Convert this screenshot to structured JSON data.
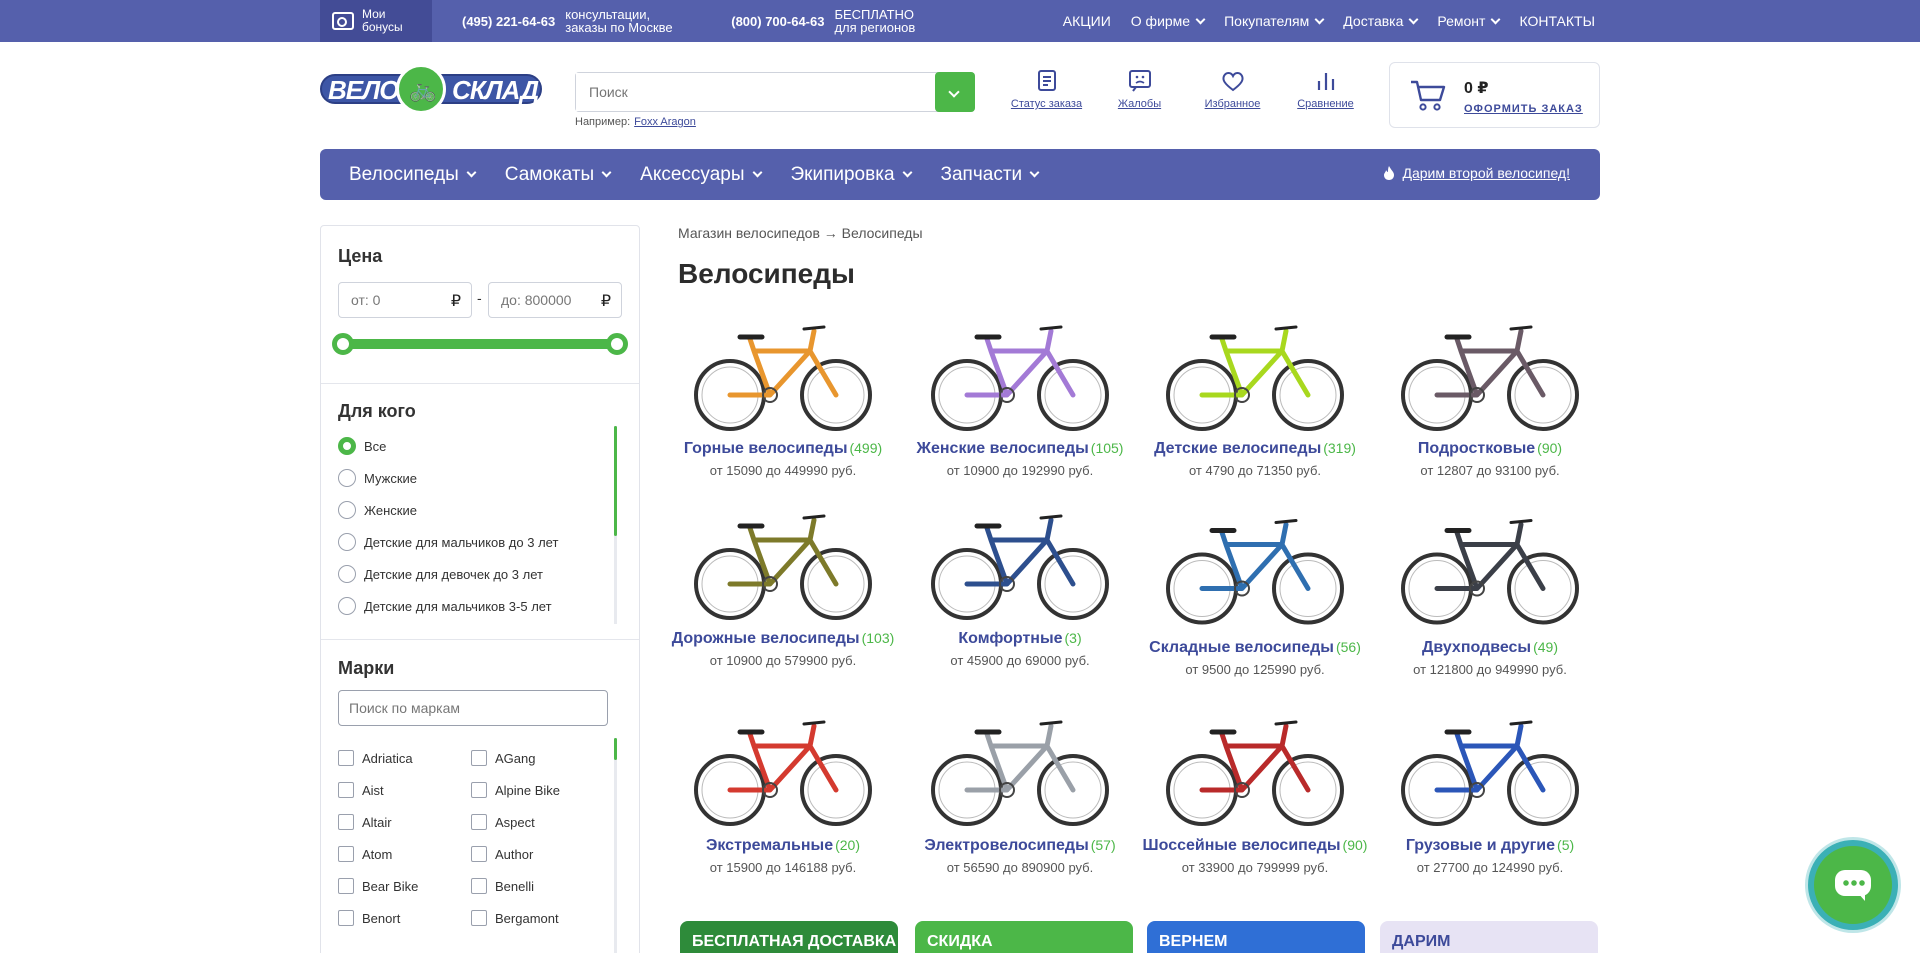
{
  "topbar": {
    "bonus": "Мои бонусы",
    "phones": [
      {
        "number": "(495) 221-64-63",
        "note": "консультации, заказы по Москве"
      },
      {
        "number": "(800) 700-64-63",
        "note": "БЕСПЛАТНО для регионов"
      }
    ],
    "nav": [
      {
        "label": "АКЦИИ",
        "dropdown": false
      },
      {
        "label": "О фирме",
        "dropdown": true
      },
      {
        "label": "Покупателям",
        "dropdown": true
      },
      {
        "label": "Доставка",
        "dropdown": true
      },
      {
        "label": "Ремонт",
        "dropdown": true
      },
      {
        "label": "КОНТАКТЫ",
        "dropdown": false
      }
    ]
  },
  "logo": {
    "left": "ВЕЛО",
    "right": "СКЛАД"
  },
  "search": {
    "placeholder": "Поиск",
    "example_label": "Например:",
    "example_link": "Foxx Aragon"
  },
  "header_icons": [
    {
      "icon": "order-status-icon",
      "label": "Статус заказа"
    },
    {
      "icon": "complaints-icon",
      "label": "Жалобы"
    },
    {
      "icon": "heart-icon",
      "label": "Избранное"
    },
    {
      "icon": "compare-icon",
      "label": "Сравнение"
    }
  ],
  "cart": {
    "sum": "0 ₽",
    "order": "ОФОРМИТЬ ЗАКАЗ"
  },
  "main_nav": {
    "items": [
      "Велосипеды",
      "Самокаты",
      "Аксессуары",
      "Экипировка",
      "Запчасти"
    ],
    "promo": "Дарим второй велосипед!"
  },
  "filters": {
    "price": {
      "title": "Цена",
      "from": "от: 0",
      "to": "до: 800000",
      "currency": "₽"
    },
    "who": {
      "title": "Для кого",
      "options": [
        "Все",
        "Мужские",
        "Женские",
        "Детские для мальчиков до 3 лет",
        "Детские для девочек до 3 лет",
        "Детские для мальчиков 3-5 лет"
      ],
      "selected": 0
    },
    "brands": {
      "title": "Марки",
      "placeholder": "Поиск по маркам",
      "col1": [
        "Adriatica",
        "Aist",
        "Altair",
        "Atom",
        "Bear Bike",
        "Benort"
      ],
      "col2": [
        "AGang",
        "Alpine Bike",
        "Aspect",
        "Author",
        "Benelli",
        "Bergamont"
      ]
    }
  },
  "breadcrumbs": "Магазин велосипедов → Велосипеды",
  "page_title": "Велосипеды",
  "categories": [
    {
      "name": "Горные велосипеды",
      "count": "(499)",
      "range": "от 15090 до 449990 руб.",
      "color": "#e8962e"
    },
    {
      "name": "Женские велосипеды",
      "count": "(105)",
      "range": "от 10900 до 192990 руб.",
      "color": "#a37ad6"
    },
    {
      "name": "Детские велосипеды",
      "count": "(319)",
      "range": "от 4790 до 71350 руб.",
      "color": "#a8d81e"
    },
    {
      "name": "Подростковые",
      "count": "(90)",
      "range": "от 12807 до 93100 руб.",
      "color": "#6a5a66"
    },
    {
      "name": "Дорожные велосипеды",
      "count": "(103)",
      "range": "от 10900 до 579900 руб.",
      "color": "#7d7a2a"
    },
    {
      "name": "Комфортные",
      "count": "(3)",
      "range": "от 45900 до 69000 руб.",
      "color": "#2d4f8e"
    },
    {
      "name": "Складные велосипеды",
      "count": "(56)",
      "range": "от 9500 до 125990 руб.",
      "color": "#2f6fb0"
    },
    {
      "name": "Двухподвесы",
      "count": "(49)",
      "range": "от 121800 до 949990 руб.",
      "color": "#3b3f48"
    },
    {
      "name": "Экстремальные",
      "count": "(20)",
      "range": "от 15900 до 146188 руб.",
      "color": "#d43a2f"
    },
    {
      "name": "Электровелосипеды",
      "count": "(57)",
      "range": "от 56590 до 890900 руб.",
      "color": "#9aa0a8"
    },
    {
      "name": "Шоссейные велосипеды",
      "count": "(90)",
      "range": "от 33900 до 799999 руб.",
      "color": "#b92a2a"
    },
    {
      "name": "Грузовые и другие",
      "count": "(5)",
      "range": "от 27700 до 124990 руб.",
      "color": "#2b56b8"
    }
  ],
  "banners": [
    {
      "text": "БЕСПЛАТНАЯ ДОСТАВКА",
      "color": "#2e8b3a"
    },
    {
      "text": "СКИДКА",
      "color": "#4cb748"
    },
    {
      "text": "ВЕРНЕМ",
      "color": "#2f6fd6"
    },
    {
      "text": "ДАРИМ",
      "color": "#e7e3f4"
    }
  ],
  "colors": {
    "primary": "#5560ac",
    "accent": "#4cb748",
    "link": "#3d4a9a"
  }
}
